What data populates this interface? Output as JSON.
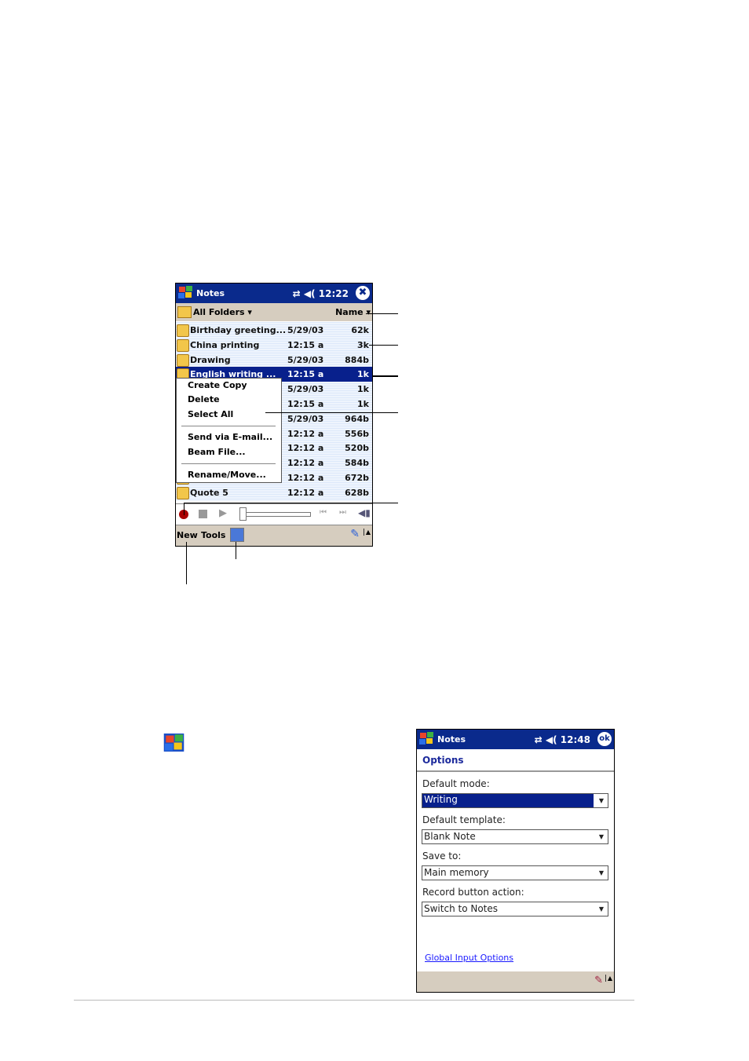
{
  "screen1": {
    "title": "Notes",
    "time": "12:22",
    "close": "✖",
    "folder": "All Folders",
    "sort": "Name",
    "notes": [
      {
        "name": "Birthday greeting...",
        "date": "5/29/03",
        "size": "62k"
      },
      {
        "name": "China printing",
        "date": "12:15 a",
        "size": "3k"
      },
      {
        "name": "Drawing",
        "date": "5/29/03",
        "size": "884b"
      },
      {
        "name": "English writing ...",
        "date": "12:15 a",
        "size": "1k",
        "selected": true
      },
      {
        "name": "",
        "date": "5/29/03",
        "size": "1k"
      },
      {
        "name": "",
        "date": "12:15 a",
        "size": "1k"
      },
      {
        "name": "",
        "date": "5/29/03",
        "size": "964b"
      },
      {
        "name": "",
        "date": "12:12 a",
        "size": "556b"
      },
      {
        "name": "",
        "date": "12:12 a",
        "size": "520b"
      },
      {
        "name": "",
        "date": "12:12 a",
        "size": "584b"
      },
      {
        "name": "",
        "date": "12:12 a",
        "size": "672b"
      },
      {
        "name": "Quote 5",
        "date": "12:12 a",
        "size": "628b"
      }
    ],
    "context_menu": [
      "Create Copy",
      "Delete",
      "Select All",
      "Send via E-mail...",
      "Beam File...",
      "Rename/Move..."
    ],
    "command_bar": {
      "new": "New",
      "tools": "Tools"
    }
  },
  "screen2": {
    "title": "Notes",
    "time": "12:48",
    "ok": "ok",
    "heading": "Options",
    "fields": [
      {
        "label": "Default mode:",
        "value": "Writing",
        "highlighted": true
      },
      {
        "label": "Default template:",
        "value": "Blank Note"
      },
      {
        "label": "Save to:",
        "value": "Main memory"
      },
      {
        "label": "Record button action:",
        "value": "Switch to Notes"
      }
    ],
    "link": "Global Input Options"
  },
  "colors": {
    "titlebar": "#0a2a8c",
    "selection": "#08208c",
    "bar": "#d6cdbf",
    "link": "#1a1aff"
  }
}
